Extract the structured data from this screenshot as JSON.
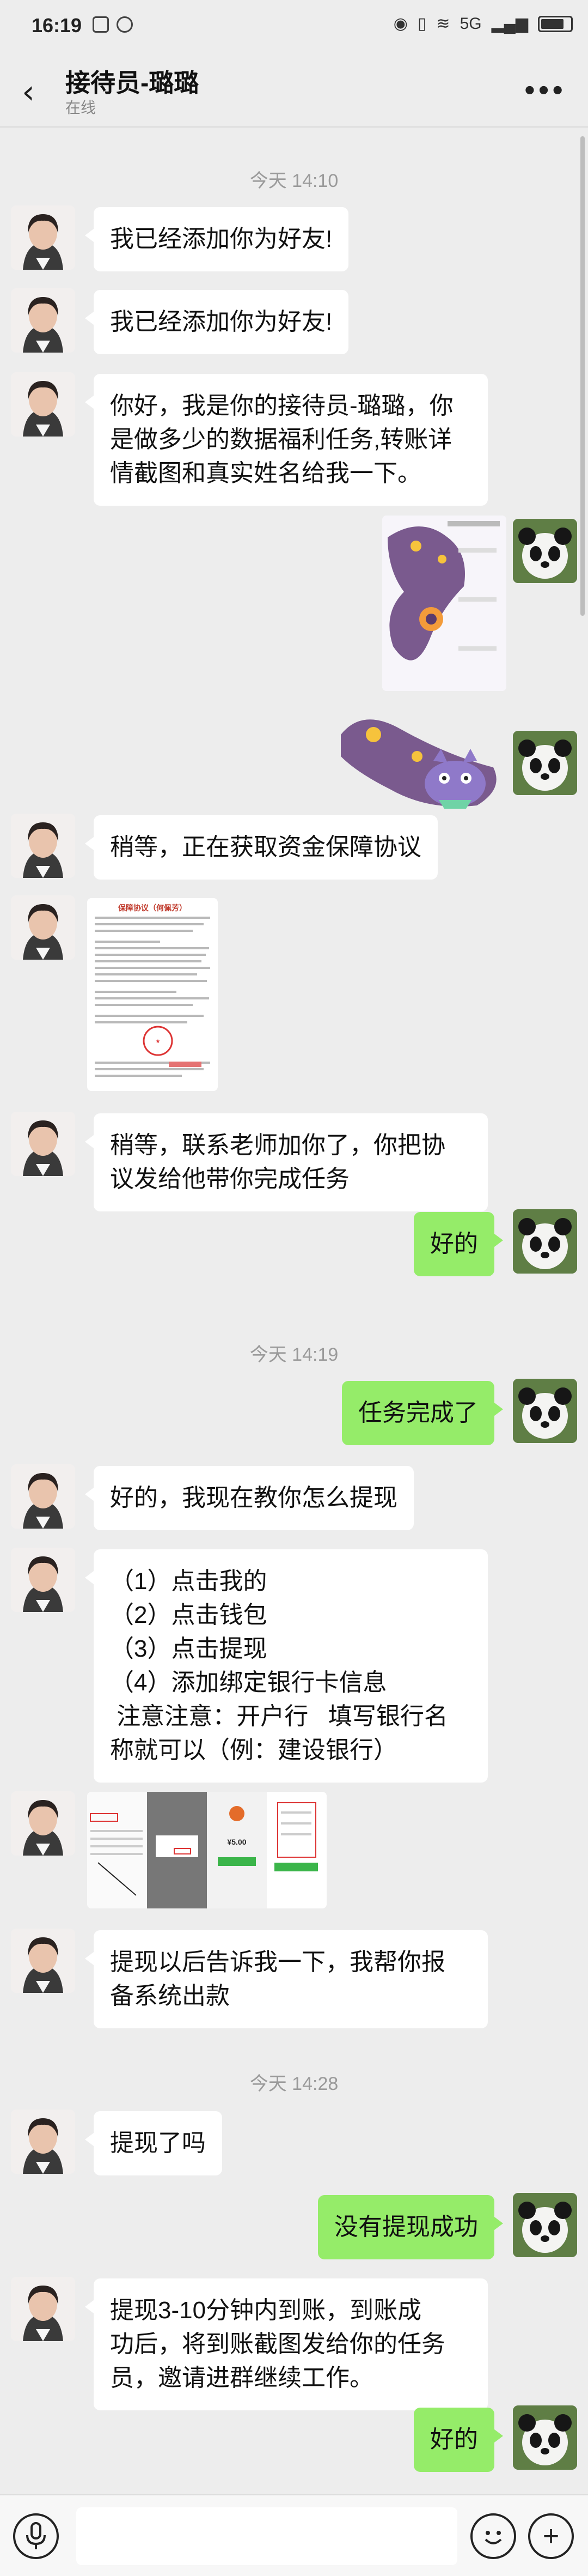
{
  "status_bar": {
    "time": "16:19",
    "network_label": "5G",
    "battery": "85"
  },
  "header": {
    "back_icon": "chevron-left-icon",
    "contact_name": "接待员-璐璐",
    "presence": "在线",
    "more_icon": "more-dots-icon"
  },
  "timestamps": [
    "今天 14:10",
    "今天 14:19",
    "今天 14:28"
  ],
  "messages": [
    {
      "from": "agent",
      "lines": [
        "我已经添加你为好友!"
      ]
    },
    {
      "from": "agent",
      "lines": [
        "我已经添加你为好友!"
      ]
    },
    {
      "from": "agent",
      "lines": [
        "你好，我是你的接待员-璐璐，你",
        "是做多少的数据福利任务,转账详",
        "情截图和真实姓名给我一下。"
      ]
    },
    {
      "from": "agent",
      "lines": [
        "稍等，正在获取资金保障协议"
      ]
    },
    {
      "from": "agent",
      "lines": [
        "稍等，联系老师加你了，你把协",
        "议发给他带你完成任务"
      ]
    },
    {
      "from": "me",
      "lines": [
        "好的"
      ]
    },
    {
      "from": "me",
      "lines": [
        "任务完成了"
      ]
    },
    {
      "from": "agent",
      "lines": [
        "好的，我现在教你怎么提现"
      ]
    },
    {
      "from": "agent",
      "lines": [
        "（1）点击我的",
        "（2）点击钱包",
        "（3）点击提现",
        "（4）添加绑定银行卡信息",
        " 注意注意：开户行   填写银行名",
        "称就可以（例：建设银行）"
      ]
    },
    {
      "from": "agent",
      "lines": [
        "提现以后告诉我一下，我帮你报",
        "备系统出款"
      ]
    },
    {
      "from": "agent",
      "lines": [
        "提现了吗"
      ]
    },
    {
      "from": "me",
      "lines": [
        "没有提现成功"
      ]
    },
    {
      "from": "agent",
      "lines": [
        "提现3-10分钟内到账，到账成",
        "功后，将到账截图发给你的任务",
        "员，邀请进群继续工作。"
      ]
    },
    {
      "from": "me",
      "lines": [
        "好的"
      ]
    }
  ],
  "images": {
    "agreement_title": "保障协议（何佩芳）",
    "tutorial_amount": "¥5.00"
  },
  "input_bar": {
    "voice_icon": "microphone-icon",
    "emoji_icon": "emoji-icon",
    "plus_icon": "plus-icon",
    "message_value": ""
  },
  "colors": {
    "background": "#ededed",
    "outgoing_bubble": "#95ec69",
    "incoming_bubble": "#ffffff"
  }
}
